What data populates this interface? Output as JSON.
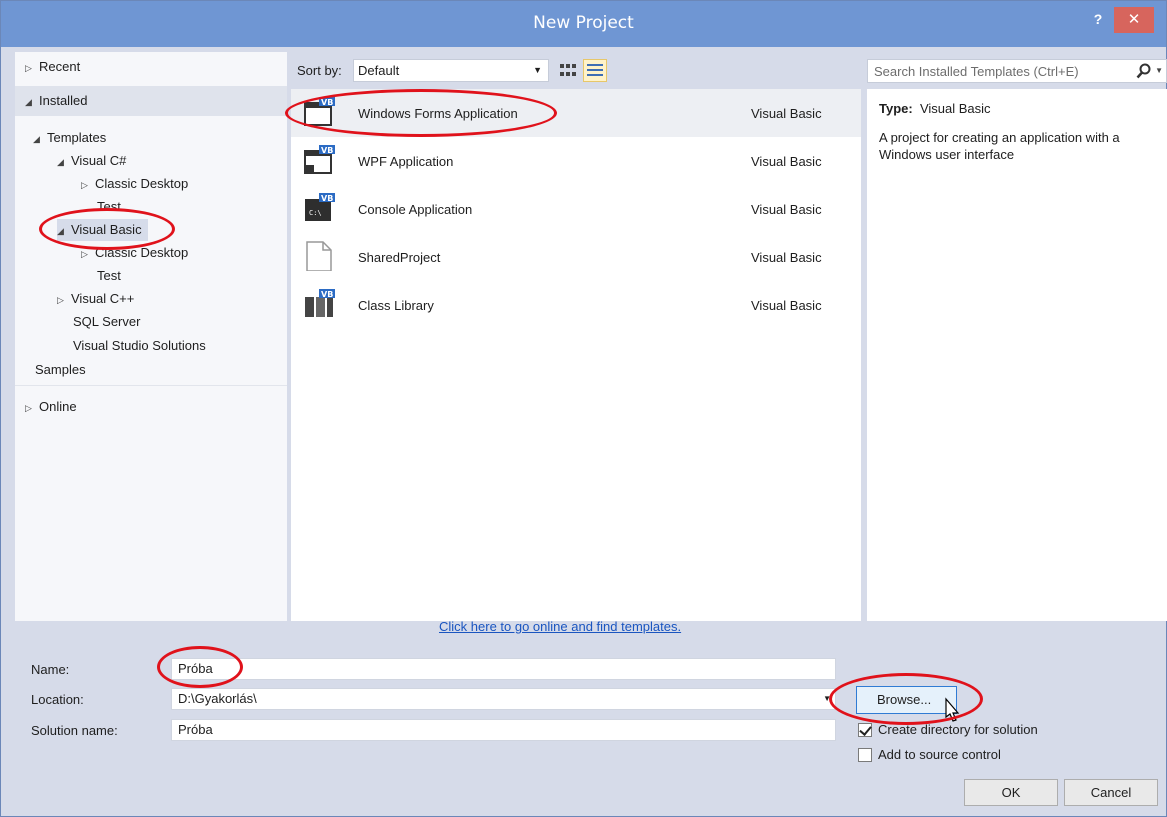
{
  "window": {
    "title": "New Project",
    "help_label": "?",
    "close_label": "✕"
  },
  "tree": {
    "recent": "Recent",
    "installed": "Installed",
    "templates": "Templates",
    "visual_csharp": "Visual C#",
    "classic_desktop_1": "Classic Desktop",
    "test_1": "Test",
    "visual_basic": "Visual Basic",
    "classic_desktop_2": "Classic Desktop",
    "test_2": "Test",
    "visual_cpp": "Visual C++",
    "sql_server": "SQL Server",
    "vs_solutions": "Visual Studio Solutions",
    "samples": "Samples",
    "online": "Online"
  },
  "sort": {
    "label": "Sort by:",
    "value": "Default"
  },
  "templates": [
    {
      "name": "Windows Forms Application",
      "lang": "Visual Basic",
      "icon": "vb-windows-forms-icon"
    },
    {
      "name": "WPF Application",
      "lang": "Visual Basic",
      "icon": "vb-wpf-icon"
    },
    {
      "name": "Console Application",
      "lang": "Visual Basic",
      "icon": "vb-console-icon"
    },
    {
      "name": "SharedProject",
      "lang": "Visual Basic",
      "icon": "shared-project-icon"
    },
    {
      "name": "Class Library",
      "lang": "Visual Basic",
      "icon": "vb-class-library-icon"
    }
  ],
  "online_link": "Click here to go online and find templates.",
  "search": {
    "placeholder": "Search Installed Templates (Ctrl+E)"
  },
  "details": {
    "type_label": "Type:",
    "type_value": "Visual Basic",
    "description": "A project for creating an application with a Windows user interface"
  },
  "form": {
    "name_label": "Name:",
    "name_value": "Próba",
    "location_label": "Location:",
    "location_value": "D:\\Gyakorlás\\",
    "solution_label": "Solution name:",
    "solution_value": "Próba",
    "browse_label": "Browse...",
    "create_dir_label": "Create directory for solution",
    "create_dir_checked": true,
    "source_control_label": "Add to source control",
    "source_control_checked": false,
    "ok_label": "OK",
    "cancel_label": "Cancel"
  },
  "colors": {
    "titlebar": "#6f96d3",
    "close": "#d7655d",
    "link": "#1a55c0",
    "annotation": "#e0121b"
  }
}
